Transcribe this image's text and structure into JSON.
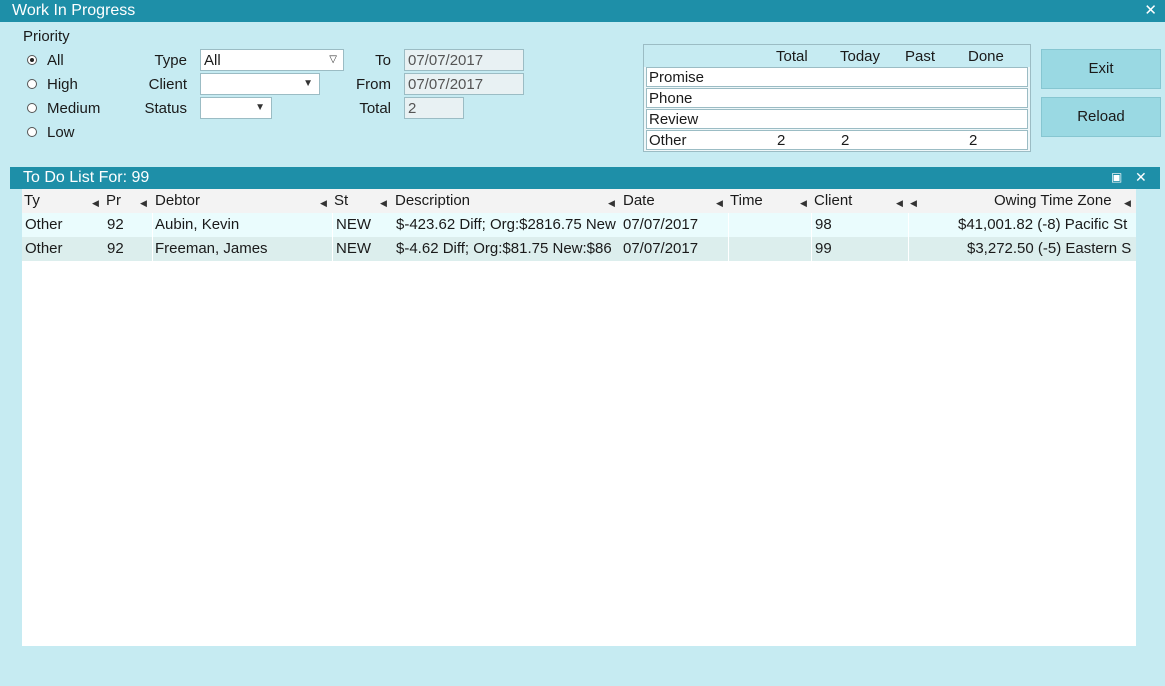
{
  "window": {
    "title": "Work In Progress",
    "close_glyph": "✕"
  },
  "priority": {
    "label": "Priority",
    "options": [
      {
        "label": "All",
        "checked": true
      },
      {
        "label": "High",
        "checked": false
      },
      {
        "label": "Medium",
        "checked": false
      },
      {
        "label": "Low",
        "checked": false
      }
    ]
  },
  "filters": {
    "type_label": "Type",
    "type_value": "All",
    "client_label": "Client",
    "client_value": "",
    "status_label": "Status",
    "status_value": "",
    "to_label": "To",
    "to_value": "07/07/2017",
    "from_label": "From",
    "from_value": "07/07/2017",
    "total_label": "Total",
    "total_value": "2"
  },
  "summary": {
    "headers": [
      "Total",
      "Today",
      "Past",
      "Done"
    ],
    "rows": [
      {
        "name": "Promise",
        "total": "",
        "today": "",
        "past": "",
        "done": ""
      },
      {
        "name": "Phone",
        "total": "",
        "today": "",
        "past": "",
        "done": ""
      },
      {
        "name": "Review",
        "total": "",
        "today": "",
        "past": "",
        "done": ""
      },
      {
        "name": "Other",
        "total": "2",
        "today": "2",
        "past": "",
        "done": "2"
      }
    ]
  },
  "buttons": {
    "exit": "Exit",
    "reload": "Reload"
  },
  "todo": {
    "title": "To Do List For:  99",
    "columns": [
      "Ty",
      "Pr",
      "Debtor",
      "St",
      "Description",
      "Date",
      "Time",
      "Client",
      "Owing Time Zone"
    ],
    "rows": [
      {
        "ty": "Other",
        "pr": "92",
        "debtor": "Aubin, Kevin",
        "st": "NEW",
        "description": "$-423.62 Diff; Org:$2816.75 New",
        "date": "07/07/2017",
        "time": "",
        "client": "98",
        "owing_tz": "$41,001.82 (-8) Pacific St"
      },
      {
        "ty": "Other",
        "pr": "92",
        "debtor": "Freeman, James",
        "st": "NEW",
        "description": "$-4.62 Diff; Org:$81.75 New:$86",
        "date": "07/07/2017",
        "time": "",
        "client": "99",
        "owing_tz": "$3,272.50 (-5) Eastern S"
      }
    ]
  }
}
